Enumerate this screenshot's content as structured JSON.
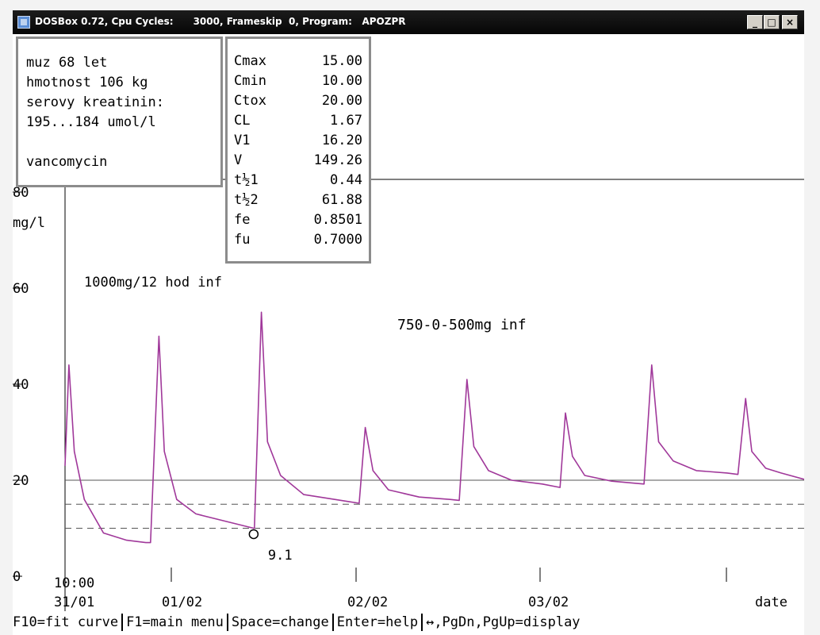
{
  "window": {
    "title": "DOSBox 0.72, Cpu Cycles:      3000, Frameskip  0, Program:   APOZPR"
  },
  "patient_panel": {
    "lines": [
      "muz 68 let",
      "hmotnost 106 kg",
      "serovy kreatinin:",
      "195...184 umol/l",
      "",
      "vancomycin"
    ]
  },
  "params_panel": {
    "rows": [
      {
        "label": "Cmax",
        "value": "15.00"
      },
      {
        "label": "Cmin",
        "value": "10.00"
      },
      {
        "label": "Ctox",
        "value": "20.00"
      },
      {
        "label": "CL",
        "value": "1.67"
      },
      {
        "label": "V1",
        "value": "16.20"
      },
      {
        "label": "V",
        "value": "149.26"
      },
      {
        "label": "t½1",
        "value": "0.44"
      },
      {
        "label": "t½2",
        "value": "61.88"
      },
      {
        "label": "fe",
        "value": "0.8501"
      },
      {
        "label": "fu",
        "value": "0.7000"
      }
    ]
  },
  "chart_data": {
    "type": "line",
    "ylabel": "mg/l",
    "xlabel": "date",
    "ylim": [
      0,
      80
    ],
    "y_ticks": [
      "0",
      "20",
      "40",
      "60",
      "80"
    ],
    "x_ticks": [
      {
        "time": "10:00",
        "date": "31/01"
      },
      {
        "date": "01/02"
      },
      {
        "date": "02/02"
      },
      {
        "date": "03/02"
      }
    ],
    "xlim_hours": [
      0,
      96
    ],
    "annotations": [
      "1000mg/12 hod inf",
      "750-0-500mg inf"
    ],
    "reference_lines": [
      {
        "name": "Ctox",
        "value": 20,
        "style": "solid"
      },
      {
        "name": "Cmax",
        "value": 15,
        "style": "dashed"
      },
      {
        "name": "Cmin",
        "value": 10,
        "style": "dashed"
      }
    ],
    "measured_point": {
      "t": 24.5,
      "value": 9.1,
      "label": "9.1"
    },
    "color": "#a0389a",
    "series": [
      {
        "points": [
          [
            0,
            23
          ],
          [
            0.5,
            44
          ],
          [
            1.2,
            26
          ],
          [
            2.5,
            16
          ],
          [
            5,
            9
          ],
          [
            8,
            7.5
          ],
          [
            10.5,
            7
          ],
          [
            11.1,
            7
          ],
          [
            12.2,
            50
          ],
          [
            12.9,
            26
          ],
          [
            14.5,
            16
          ],
          [
            17,
            13
          ],
          [
            24.5,
            10
          ],
          [
            24.6,
            10
          ],
          [
            25.5,
            55
          ],
          [
            26.3,
            28
          ],
          [
            28,
            21
          ],
          [
            31,
            17
          ],
          [
            37,
            15.5
          ],
          [
            38.2,
            15.2
          ],
          [
            39,
            31
          ],
          [
            40,
            22
          ],
          [
            42,
            18
          ],
          [
            46,
            16.5
          ],
          [
            50,
            16
          ],
          [
            51.2,
            15.8
          ],
          [
            52.2,
            41
          ],
          [
            53.1,
            27
          ],
          [
            55,
            22
          ],
          [
            58,
            20
          ],
          [
            62,
            19.2
          ],
          [
            64.3,
            18.5
          ],
          [
            65,
            34
          ],
          [
            65.9,
            25
          ],
          [
            67.5,
            21
          ],
          [
            71,
            19.8
          ],
          [
            75.2,
            19.2
          ],
          [
            76.2,
            44
          ],
          [
            77.1,
            28
          ],
          [
            79,
            24
          ],
          [
            82,
            22
          ],
          [
            86,
            21.5
          ],
          [
            87.4,
            21.2
          ],
          [
            88.4,
            37
          ],
          [
            89.2,
            26
          ],
          [
            91,
            22.5
          ],
          [
            93,
            21.5
          ],
          [
            96,
            20.2
          ]
        ]
      }
    ]
  },
  "statusbar": {
    "items": [
      "F10=fit curve",
      "F1=main menu",
      "Space=change",
      "Enter=help",
      "↔,PgDn,PgUp=display"
    ]
  }
}
